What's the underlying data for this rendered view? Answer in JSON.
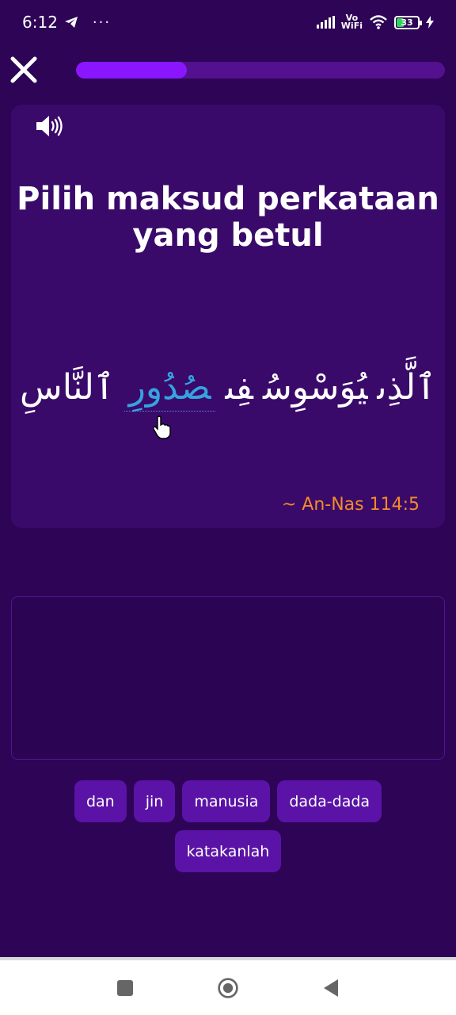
{
  "status_bar": {
    "time": "6:12",
    "more": "···",
    "vowifi_top": "Vo",
    "vowifi_bottom": "WiFi",
    "battery": "33"
  },
  "header": {
    "progress_fraction": 0.3
  },
  "question_card": {
    "prompt": "Pilih maksud perkataan yang betul",
    "arabic_words": [
      "ٱلَّذِى",
      "يُوَسْوِسُ",
      "فِى",
      "صُدُورِ",
      "ٱلنَّاسِ"
    ],
    "highlighted_index": 3,
    "reference": "~ An-Nas 114:5"
  },
  "word_choices": [
    "dan",
    "jin",
    "manusia",
    "dada-dada",
    "katakanlah"
  ],
  "colors": {
    "background": "#2e0457",
    "card": "#3a0a6a",
    "progress_fill": "#8a16ff",
    "progress_track": "#54118f",
    "highlight": "#36a3e0",
    "reference": "#f28a2b",
    "chip": "#5a13a6"
  },
  "icons": {
    "close": "close-icon",
    "speaker": "speaker-icon",
    "telegram": "telegram-icon",
    "signal": "signal-icon",
    "wifi": "wifi-icon",
    "battery": "battery-icon",
    "charging": "bolt-icon",
    "cursor": "hand-cursor-icon",
    "nav_recents": "square-icon",
    "nav_home": "circle-icon",
    "nav_back": "triangle-back-icon"
  }
}
